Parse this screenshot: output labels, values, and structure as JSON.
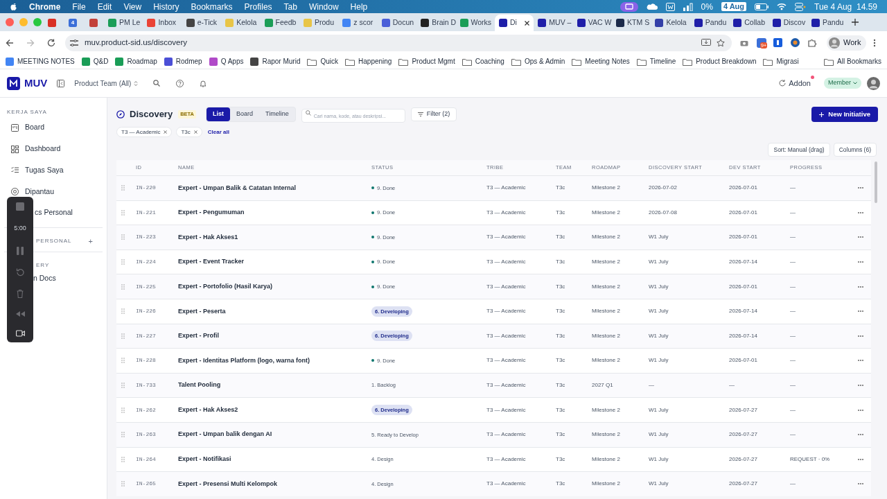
{
  "menu_bar": {
    "app": "Chrome",
    "items": [
      "File",
      "Edit",
      "View",
      "History",
      "Bookmarks",
      "Profiles",
      "Tab",
      "Window",
      "Help"
    ],
    "battery_text": "0%",
    "date_badge": "4 Aug",
    "clock": "Tue 4 Aug  14.59"
  },
  "browser": {
    "tabs": [
      {
        "color": "#d93025",
        "selected": false
      },
      {
        "icon_text": "4",
        "color": "#3b6fd8",
        "selected": false
      },
      {
        "color": "#c2413a",
        "selected": false
      },
      {
        "title": "PM Le",
        "color": "#1a9d57",
        "selected": false
      },
      {
        "title": "Inbox",
        "color": "#ea4335",
        "selected": false
      },
      {
        "title": "e-Tick",
        "color": "#444444",
        "selected": false
      },
      {
        "title": "Kelola",
        "color": "#e8c547",
        "selected": false
      },
      {
        "title": "Feedb",
        "color": "#1a9d57",
        "selected": false
      },
      {
        "title": "Produ",
        "color": "#e8c547",
        "selected": false
      },
      {
        "title": "z scor",
        "color": "#4285f4",
        "selected": false
      },
      {
        "title": "Docun",
        "color": "#4a5fd8",
        "selected": false
      },
      {
        "title": "Brain D",
        "color": "#222222",
        "selected": false
      },
      {
        "title": "Works",
        "color": "#1a9d57",
        "selected": false
      },
      {
        "title": "Di",
        "color": "#1f1fa8",
        "selected": true
      },
      {
        "title": "MUV –",
        "color": "#1f1fa8",
        "selected": false
      },
      {
        "title": "VAC W",
        "color": "#1f1fa8",
        "selected": false
      },
      {
        "title": "KTM S",
        "color": "#1b2a4a",
        "selected": false
      },
      {
        "title": "Kelola",
        "color": "#3340a8",
        "selected": false
      },
      {
        "title": "Pandu",
        "color": "#1f1fa8",
        "selected": false
      },
      {
        "title": "Collab",
        "color": "#1f1fa8",
        "selected": false
      },
      {
        "title": "Discov",
        "color": "#1f1fa8",
        "selected": false
      },
      {
        "title": "Pandu",
        "color": "#1f1fa8",
        "selected": false
      }
    ],
    "address": "muv.product-sid.us/discovery",
    "extension_badge": "9+",
    "profile": "Work",
    "bookmarks": [
      {
        "label": "MEETING NOTES",
        "color": "#4285f4"
      },
      {
        "label": "Q&D",
        "color": "#1a9d57"
      },
      {
        "label": "Roadmap",
        "color": "#1a9d57"
      },
      {
        "label": "Rodmep",
        "color": "#4b4fd6"
      },
      {
        "label": "Q Apps",
        "color": "#b04ac8"
      },
      {
        "label": "Rapor Murid",
        "color": "#444444"
      },
      {
        "label": "Quick",
        "kind": "folder"
      },
      {
        "label": "Happening",
        "kind": "folder"
      },
      {
        "label": "Product Mgmt",
        "kind": "folder"
      },
      {
        "label": "Coaching",
        "kind": "folder"
      },
      {
        "label": "Ops & Admin",
        "kind": "folder"
      },
      {
        "label": "Meeting Notes",
        "kind": "folder"
      },
      {
        "label": "Timeline",
        "kind": "folder"
      },
      {
        "label": "Product Breakdown",
        "kind": "folder"
      },
      {
        "label": "Migrasi",
        "kind": "folder"
      }
    ],
    "all_bookmarks": "All Bookmarks"
  },
  "header": {
    "brand": "MUV",
    "team_select": "Product Team (All)",
    "addon": "Addon",
    "role": "Member"
  },
  "sidebar": {
    "sections": [
      {
        "heading": "KERJA SAYA",
        "items": [
          "Board",
          "Dashboard",
          "Tugas Saya",
          "Dipantau",
          "cs Personal"
        ]
      },
      {
        "heading": "PERSONAL",
        "add": "+"
      },
      {
        "heading": "ERY",
        "items": [
          "n Docs"
        ]
      }
    ]
  },
  "page": {
    "title": "Discovery",
    "badge": "BETA",
    "views": [
      {
        "label": "List",
        "selected": true
      },
      {
        "label": "Board",
        "selected": false
      },
      {
        "label": "Timeline",
        "selected": false
      }
    ],
    "search": {
      "placeholder": "Cari nama, kode, atau deskripsi..."
    },
    "filter": "Filter (2)",
    "new_button": "New Initiative",
    "chips": [
      "T3 — Academic",
      "T3c"
    ],
    "clear": "Clear all",
    "sort": "Sort: Manual (drag)",
    "columns_button": "Columns (6)"
  },
  "table": {
    "columns": [
      "ID",
      "NAME",
      "STATUS",
      "TRIBE",
      "TEAM",
      "ROADMAP",
      "DISCOVERY START",
      "DEV START",
      "PROGRESS"
    ],
    "rows": [
      {
        "id": "IN-220",
        "name": "Expert - Umpan Balik & Catatan Internal",
        "status": {
          "label": "9. Done",
          "kind": "dot"
        },
        "tribe": "T3 — Academic",
        "team": "T3c",
        "roadmap": "Milestone 2",
        "discovery_start": "2026-07-02",
        "dev_start": "2026-07-01",
        "progress": "—"
      },
      {
        "id": "IN-221",
        "name": "Expert - Pengumuman",
        "status": {
          "label": "9. Done",
          "kind": "dot"
        },
        "tribe": "T3 — Academic",
        "team": "T3c",
        "roadmap": "Milestone 2",
        "discovery_start": "2026-07-08",
        "dev_start": "2026-07-01",
        "progress": "—"
      },
      {
        "id": "IN-223",
        "name": "Expert - Hak Akses1",
        "status": {
          "label": "9. Done",
          "kind": "dot"
        },
        "tribe": "T3 — Academic",
        "team": "T3c",
        "roadmap": "Milestone 2",
        "discovery_start": "W1 July",
        "dev_start": "2026-07-01",
        "progress": "—"
      },
      {
        "id": "IN-224",
        "name": "Expert - Event Tracker",
        "status": {
          "label": "9. Done",
          "kind": "dot"
        },
        "tribe": "T3 — Academic",
        "team": "T3c",
        "roadmap": "Milestone 2",
        "discovery_start": "W1 July",
        "dev_start": "2026-07-14",
        "progress": "—"
      },
      {
        "id": "IN-225",
        "name": "Expert - Portofolio (Hasil Karya)",
        "status": {
          "label": "9. Done",
          "kind": "dot"
        },
        "tribe": "T3 — Academic",
        "team": "T3c",
        "roadmap": "Milestone 2",
        "discovery_start": "W1 July",
        "dev_start": "2026-07-01",
        "progress": "—"
      },
      {
        "id": "IN-226",
        "name": "Expert - Peserta",
        "status": {
          "label": "6. Developing",
          "kind": "pill"
        },
        "tribe": "T3 — Academic",
        "team": "T3c",
        "roadmap": "Milestone 2",
        "discovery_start": "W1 July",
        "dev_start": "2026-07-14",
        "progress": "—"
      },
      {
        "id": "IN-227",
        "name": "Expert - Profil",
        "status": {
          "label": "6. Developing",
          "kind": "pill"
        },
        "tribe": "T3 — Academic",
        "team": "T3c",
        "roadmap": "Milestone 2",
        "discovery_start": "W1 July",
        "dev_start": "2026-07-14",
        "progress": "—"
      },
      {
        "id": "IN-228",
        "name": "Expert - Identitas Platform (logo, warna font)",
        "status": {
          "label": "9. Done",
          "kind": "dot"
        },
        "tribe": "T3 — Academic",
        "team": "T3c",
        "roadmap": "Milestone 2",
        "discovery_start": "W1 July",
        "dev_start": "2026-07-01",
        "progress": "—"
      },
      {
        "id": "IN-733",
        "name": "Talent Pooling",
        "status": {
          "label": "1. Backlog",
          "kind": "plain"
        },
        "tribe": "T3 — Academic",
        "team": "T3c",
        "roadmap": "2027 Q1",
        "discovery_start": "—",
        "dev_start": "—",
        "progress": "—"
      },
      {
        "id": "IN-262",
        "name": "Expert - Hak Akses2",
        "status": {
          "label": "6. Developing",
          "kind": "pill"
        },
        "tribe": "T3 — Academic",
        "team": "T3c",
        "roadmap": "Milestone 2",
        "discovery_start": "W1 July",
        "dev_start": "2026-07-27",
        "progress": "—"
      },
      {
        "id": "IN-263",
        "name": "Expert - Umpan balik dengan AI",
        "status": {
          "label": "5. Ready to Develop",
          "kind": "plain"
        },
        "tribe": "T3 — Academic",
        "team": "T3c",
        "roadmap": "Milestone 2",
        "discovery_start": "W1 July",
        "dev_start": "2026-07-27",
        "progress": "—"
      },
      {
        "id": "IN-264",
        "name": "Expert - Notifikasi",
        "status": {
          "label": "4. Design",
          "kind": "plain"
        },
        "tribe": "T3 — Academic",
        "team": "T3c",
        "roadmap": "Milestone 2",
        "discovery_start": "W1 July",
        "dev_start": "2026-07-27",
        "progress": "REQUEST · 0%"
      },
      {
        "id": "IN-265",
        "name": "Expert - Presensi Multi Kelompok",
        "status": {
          "label": "4. Design",
          "kind": "plain"
        },
        "tribe": "T3 — Academic",
        "team": "T3c",
        "roadmap": "Milestone 2",
        "discovery_start": "W1 July",
        "dev_start": "2026-07-27",
        "progress": "—"
      }
    ]
  },
  "recorder": {
    "timer": "5:00"
  }
}
